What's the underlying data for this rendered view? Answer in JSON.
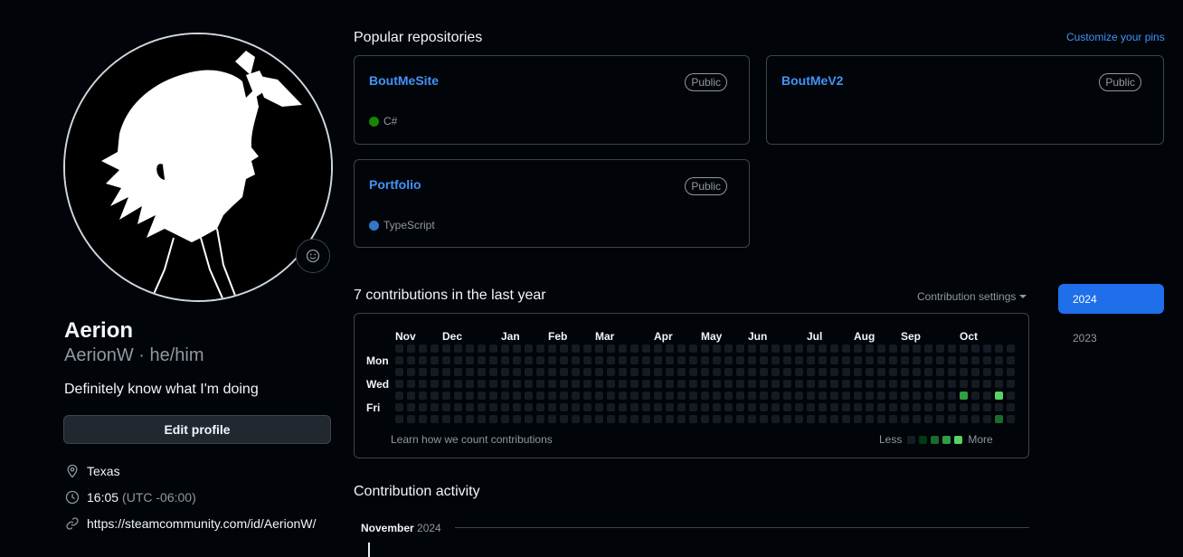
{
  "profile": {
    "name": "Aerion",
    "login": "AerionW",
    "pronouns": "he/him",
    "login_line": "AerionW · he/him",
    "bio": "Definitely know what I'm doing",
    "edit_label": "Edit profile",
    "location": "Texas",
    "time": "16:05",
    "timezone": "(UTC -06:00)",
    "website": "https://steamcommunity.com/id/AerionW/"
  },
  "popular": {
    "title": "Popular repositories",
    "customize_label": "Customize your pins",
    "repos": [
      {
        "name": "BoutMeSite",
        "visibility": "Public",
        "language": "C#",
        "language_color": "#178600"
      },
      {
        "name": "BoutMeV2",
        "visibility": "Public",
        "language": "",
        "language_color": ""
      },
      {
        "name": "Portfolio",
        "visibility": "Public",
        "language": "TypeScript",
        "language_color": "#3178c6"
      }
    ]
  },
  "contributions": {
    "title": "7 contributions in the last year",
    "settings_label": "Contribution settings",
    "months": [
      "Nov",
      "Dec",
      "Jan",
      "Feb",
      "Mar",
      "Apr",
      "May",
      "Jun",
      "Jul",
      "Aug",
      "Sep",
      "Oct"
    ],
    "day_labels": [
      "Mon",
      "Wed",
      "Fri"
    ],
    "learn_label": "Learn how we count contributions",
    "less_label": "Less",
    "more_label": "More",
    "level_colors": [
      "#151b23",
      "#033a16",
      "#196c2e",
      "#2ea043",
      "#56d364"
    ],
    "active_cells": [
      {
        "week": 49,
        "day": 5,
        "level": 3
      },
      {
        "week": 52,
        "day": 5,
        "level": 4
      },
      {
        "week": 52,
        "day": 7,
        "level": 2
      }
    ]
  },
  "years": [
    {
      "label": "2024",
      "active": true
    },
    {
      "label": "2023",
      "active": false
    }
  ],
  "activity": {
    "title": "Contribution activity",
    "month": "November",
    "year": "2024"
  },
  "icons": {
    "status": "smiley-icon",
    "location": "location-pin-icon",
    "time": "clock-icon",
    "link": "link-icon",
    "dropdown": "caret-down-icon"
  }
}
